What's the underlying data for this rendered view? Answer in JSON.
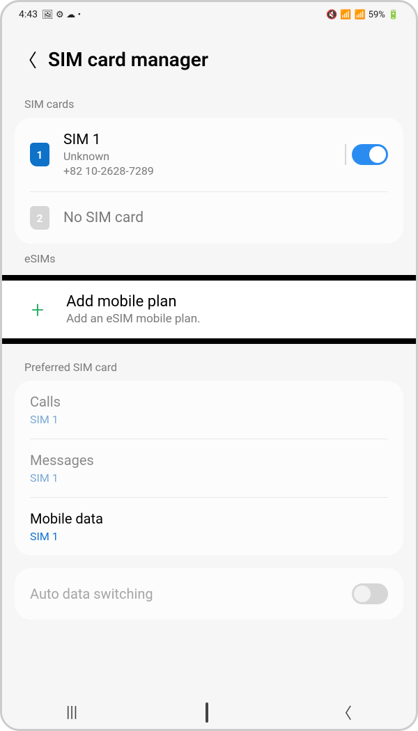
{
  "status": {
    "time": "4:43",
    "battery_percent": "59%"
  },
  "header": {
    "title": "SIM card manager"
  },
  "sections": {
    "sim_cards_label": "SIM cards",
    "esims_label": "eSIMs",
    "preferred_label": "Preferred SIM card"
  },
  "sims": [
    {
      "slot": "1",
      "name": "SIM 1",
      "status": "Unknown",
      "phone": "+82 10-2628-7289",
      "enabled": true
    },
    {
      "slot": "2",
      "name": "No SIM card"
    }
  ],
  "esim": {
    "add_title": "Add mobile plan",
    "add_subtitle": "Add an eSIM mobile plan."
  },
  "preferred": {
    "calls": {
      "label": "Calls",
      "value": "SIM 1"
    },
    "messages": {
      "label": "Messages",
      "value": "SIM 1"
    },
    "data": {
      "label": "Mobile data",
      "value": "SIM 1"
    }
  },
  "auto_switch": {
    "label": "Auto data switching",
    "enabled": false
  }
}
